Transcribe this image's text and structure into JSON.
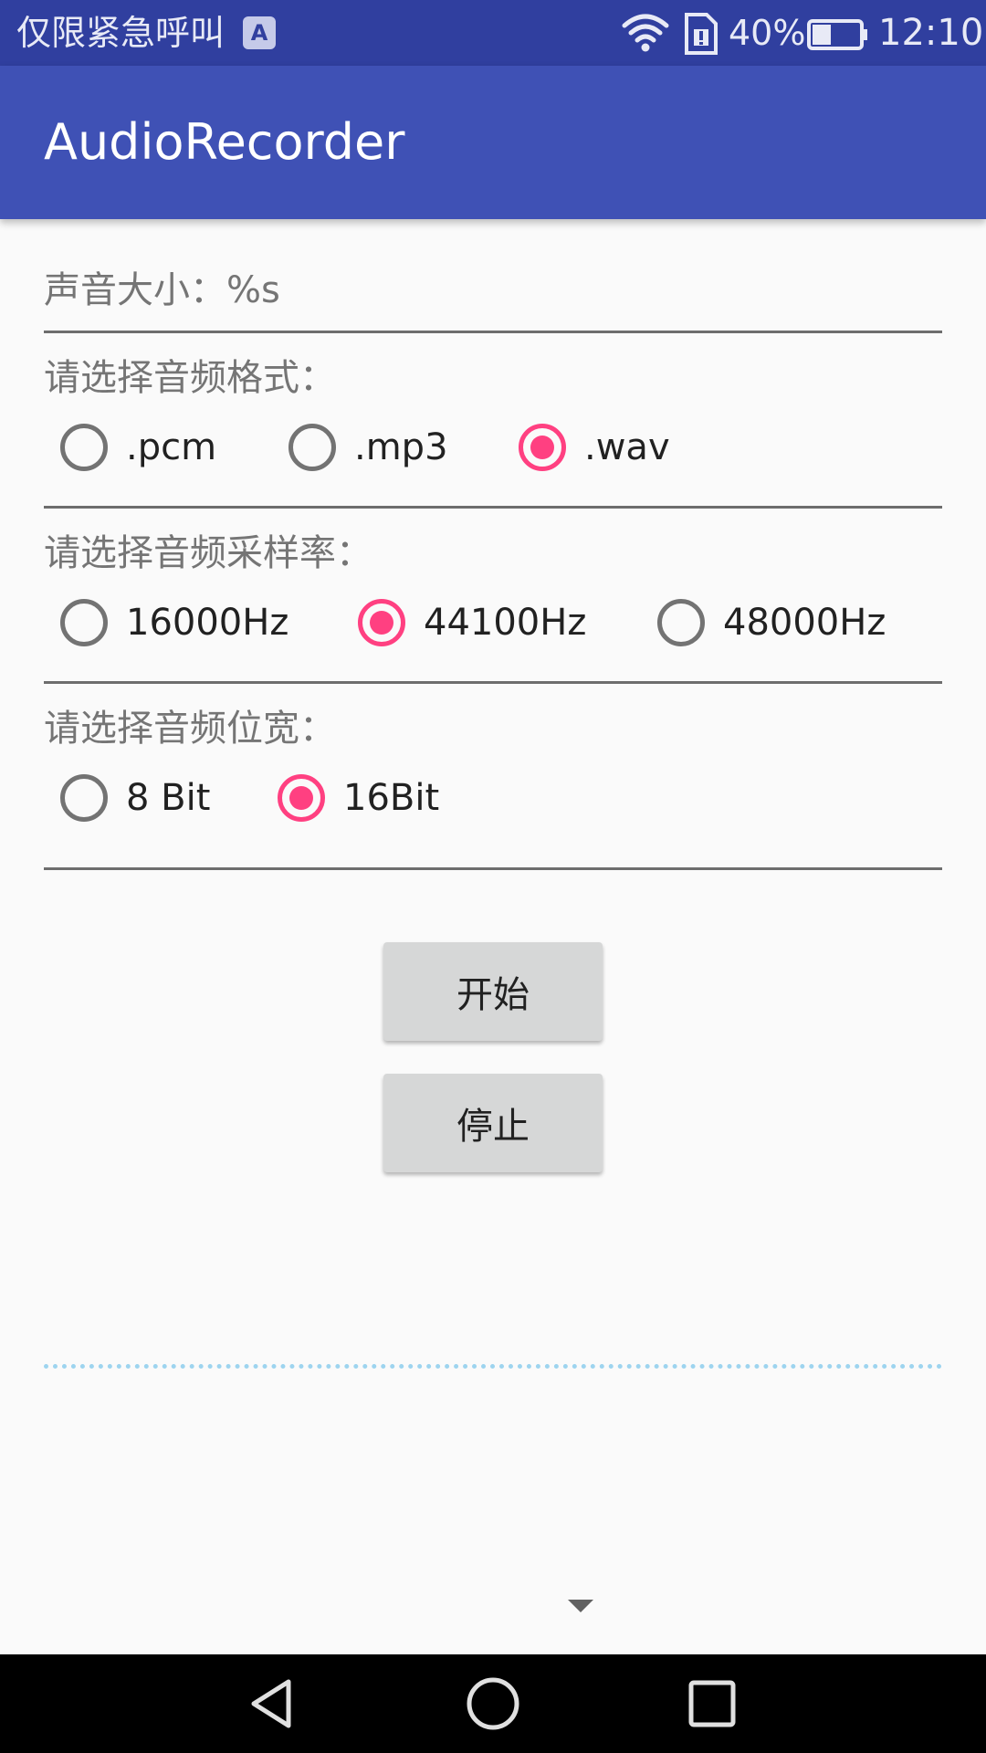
{
  "status_bar": {
    "carrier": "仅限紧急呼叫",
    "ime_badge": "A",
    "battery_percent": "40%",
    "battery_level": 0.4,
    "time": "12:10",
    "icons": [
      "wifi-icon",
      "sim-icon",
      "battery-icon"
    ]
  },
  "app_bar": {
    "title": "AudioRecorder"
  },
  "volume": {
    "label": "声音大小：%s"
  },
  "format_section": {
    "label": "请选择音频格式：",
    "options": [
      {
        "label": ".pcm",
        "checked": false
      },
      {
        "label": ".mp3",
        "checked": false
      },
      {
        "label": ".wav",
        "checked": true
      }
    ]
  },
  "sample_rate_section": {
    "label": "请选择音频采样率：",
    "options": [
      {
        "label": "16000Hz",
        "checked": false
      },
      {
        "label": "44100Hz",
        "checked": true
      },
      {
        "label": "48000Hz",
        "checked": false
      }
    ]
  },
  "bit_depth_section": {
    "label": "请选择音频位宽：",
    "options": [
      {
        "label": "8 Bit",
        "checked": false
      },
      {
        "label": "16Bit",
        "checked": true
      }
    ]
  },
  "buttons": {
    "start": "开始",
    "stop": "停止"
  },
  "nav_bar": {
    "icons": [
      "back-icon",
      "home-icon",
      "recent-apps-icon"
    ]
  },
  "colors": {
    "status_bar": "#303f9f",
    "app_bar": "#3f51b5",
    "accent": "#ff4081",
    "background": "#fafafa",
    "progress_line": "#9dd4ef"
  }
}
